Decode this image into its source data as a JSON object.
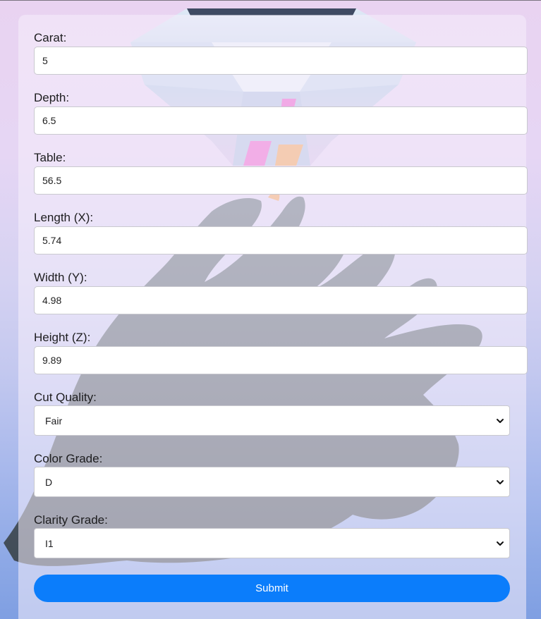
{
  "fields": [
    {
      "label": "Carat:",
      "value": "5"
    },
    {
      "label": "Depth:",
      "value": "6.5"
    },
    {
      "label": "Table:",
      "value": "56.5"
    },
    {
      "label": "Length (X):",
      "value": "5.74"
    },
    {
      "label": "Width (Y):",
      "value": "4.98"
    },
    {
      "label": "Height (Z):",
      "value": "9.89"
    }
  ],
  "selects": [
    {
      "label": "Cut Quality:",
      "value": "Fair"
    },
    {
      "label": "Color Grade:",
      "value": "D"
    },
    {
      "label": "Clarity Grade:",
      "value": "I1"
    }
  ],
  "submit_label": "Submit",
  "colors": {
    "accent": "#0b7dfb",
    "input_border": "#c9c9cf",
    "text": "#1d1d1f"
  },
  "icons": {
    "select_arrow": "chevron-down-icon"
  }
}
